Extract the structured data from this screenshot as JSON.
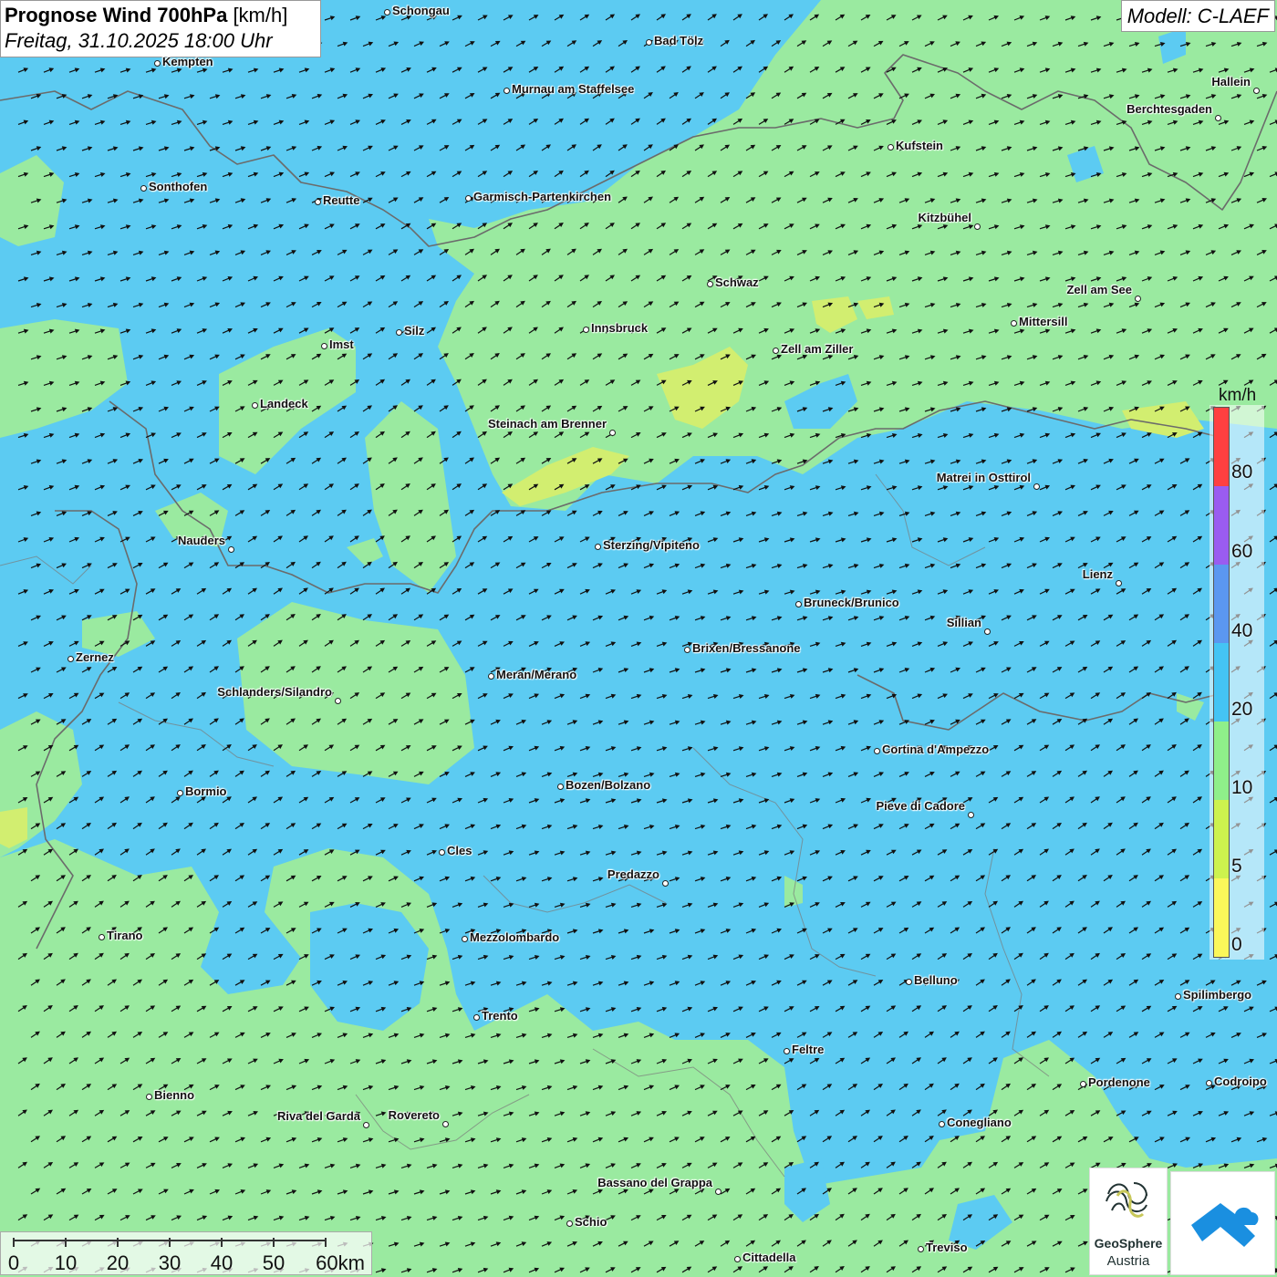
{
  "title": {
    "main": "Prognose Wind 700hPa",
    "unit": "[km/h]",
    "date": "Freitag, 31.10.2025 18:00 Uhr"
  },
  "model": "Modell: C-LAEF",
  "legend": {
    "unit": "km/h",
    "labels": [
      "80",
      "60",
      "40",
      "20",
      "10",
      "5",
      "0"
    ],
    "colors": [
      "#ff4040",
      "#9a5cf0",
      "#5b97f0",
      "#44c4f4",
      "#8fef8a",
      "#cdf24e",
      "#fbf75a"
    ]
  },
  "colors": {
    "blue_zone": "#5ccbf2",
    "green_zone": "#9aeaa0",
    "yellow_zone": "#d2ee70",
    "border": "#6b6b6b"
  },
  "scale": {
    "labels": [
      "0",
      "10",
      "20",
      "30",
      "40",
      "50",
      "60km"
    ]
  },
  "logos": {
    "geosphere_1": "GeoSphere",
    "geosphere_2": "Austria",
    "geosphere_icon": "geosphere-swirl-icon",
    "second_icon": "blue-cloud-icon"
  },
  "cities": [
    {
      "name": "Schongau"
    },
    {
      "name": "Bad Tölz"
    },
    {
      "name": "Kempten"
    },
    {
      "name": "Murnau am Staffelsee"
    },
    {
      "name": "Hallein"
    },
    {
      "name": "Berchtesgaden"
    },
    {
      "name": "Kufstein"
    },
    {
      "name": "Sonthofen"
    },
    {
      "name": "Reutte"
    },
    {
      "name": "Garmisch-Partenkirchen"
    },
    {
      "name": "Kitzbühel"
    },
    {
      "name": "Schwaz"
    },
    {
      "name": "Zell am See"
    },
    {
      "name": "Mittersill"
    },
    {
      "name": "Innsbruck"
    },
    {
      "name": "Imst"
    },
    {
      "name": "Silz"
    },
    {
      "name": "Zell am Ziller"
    },
    {
      "name": "Landeck"
    },
    {
      "name": "Steinach am Brenner"
    },
    {
      "name": "Matrei in Osttirol"
    },
    {
      "name": "Nauders"
    },
    {
      "name": "Sterzing/Vipiteno"
    },
    {
      "name": "Lienz"
    },
    {
      "name": "Bruneck/Brunico"
    },
    {
      "name": "Sillian"
    },
    {
      "name": "Brixen/Bressanone"
    },
    {
      "name": "Zernez"
    },
    {
      "name": "Meran/Merano"
    },
    {
      "name": "Schlanders/Silandro"
    },
    {
      "name": "Cortina d'Ampezzo"
    },
    {
      "name": "Bozen/Bolzano"
    },
    {
      "name": "Bormio"
    },
    {
      "name": "Pieve di Cadore"
    },
    {
      "name": "Cles"
    },
    {
      "name": "Predazzo"
    },
    {
      "name": "Tirano"
    },
    {
      "name": "Mezzolombardo"
    },
    {
      "name": "Belluno"
    },
    {
      "name": "Spilimbergo"
    },
    {
      "name": "Trento"
    },
    {
      "name": "Feltre"
    },
    {
      "name": "Pordenone"
    },
    {
      "name": "Codroipo"
    },
    {
      "name": "Bienno"
    },
    {
      "name": "Riva del Garda"
    },
    {
      "name": "Rovereto"
    },
    {
      "name": "Conegliano"
    },
    {
      "name": "Bassano del Grappa"
    },
    {
      "name": "Schio"
    },
    {
      "name": "Treviso"
    },
    {
      "name": "Cittadella"
    }
  ]
}
